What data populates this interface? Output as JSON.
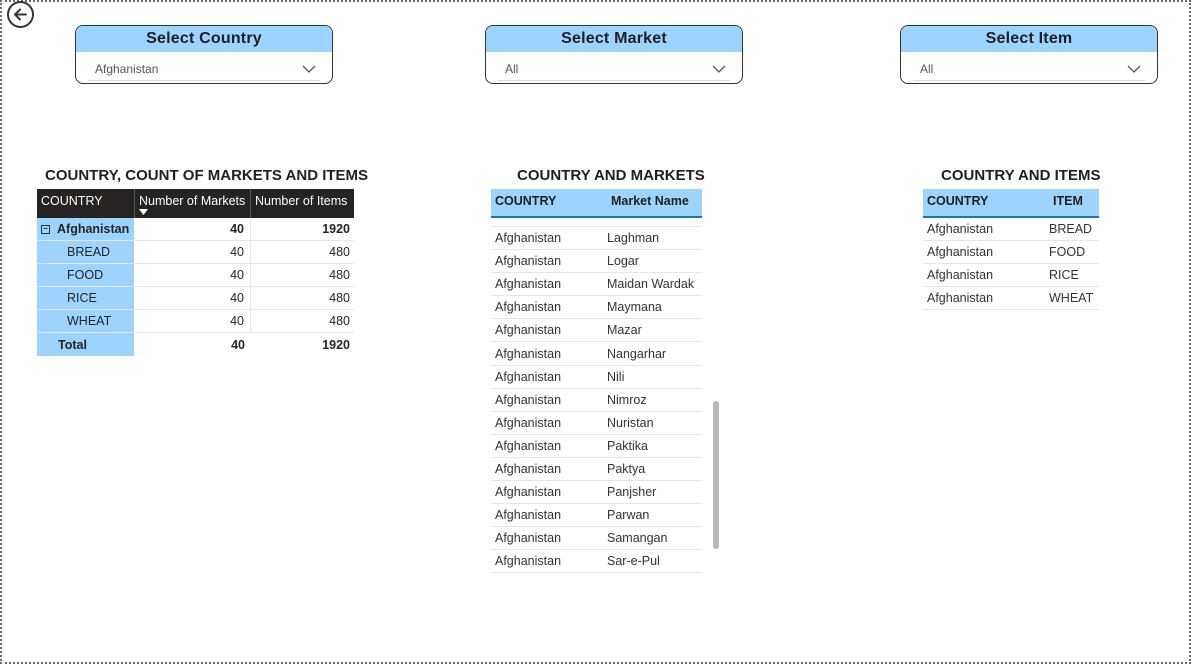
{
  "slicers": {
    "country": {
      "title": "Select Country",
      "value": "Afghanistan"
    },
    "market": {
      "title": "Select Market",
      "value": "All"
    },
    "item": {
      "title": "Select Item",
      "value": "All"
    }
  },
  "matrix": {
    "title": "COUNTRY, COUNT OF MARKETS AND ITEMS",
    "headers": [
      "COUNTRY",
      "Number of Markets",
      "Number of Items"
    ],
    "rows": [
      {
        "label": "Afghanistan",
        "markets": "40",
        "items": "1920"
      },
      {
        "label": "BREAD",
        "markets": "40",
        "items": "480"
      },
      {
        "label": "FOOD",
        "markets": "40",
        "items": "480"
      },
      {
        "label": "RICE",
        "markets": "40",
        "items": "480"
      },
      {
        "label": "WHEAT",
        "markets": "40",
        "items": "480"
      },
      {
        "label": "Total",
        "markets": "40",
        "items": "1920"
      }
    ]
  },
  "markets_table": {
    "title": "COUNTRY AND MARKETS",
    "headers": [
      "COUNTRY",
      "Market Name"
    ],
    "rows": [
      [
        "Afghanistan",
        "Laghman"
      ],
      [
        "Afghanistan",
        "Logar"
      ],
      [
        "Afghanistan",
        "Maidan Wardak"
      ],
      [
        "Afghanistan",
        "Maymana"
      ],
      [
        "Afghanistan",
        "Mazar"
      ],
      [
        "Afghanistan",
        "Nangarhar"
      ],
      [
        "Afghanistan",
        "Nili"
      ],
      [
        "Afghanistan",
        "Nimroz"
      ],
      [
        "Afghanistan",
        "Nuristan"
      ],
      [
        "Afghanistan",
        "Paktika"
      ],
      [
        "Afghanistan",
        "Paktya"
      ],
      [
        "Afghanistan",
        "Panjsher"
      ],
      [
        "Afghanistan",
        "Parwan"
      ],
      [
        "Afghanistan",
        "Samangan"
      ],
      [
        "Afghanistan",
        "Sar-e-Pul"
      ]
    ]
  },
  "items_table": {
    "title": "COUNTRY AND ITEMS",
    "headers": [
      "COUNTRY",
      "ITEM"
    ],
    "rows": [
      [
        "Afghanistan",
        "BREAD"
      ],
      [
        "Afghanistan",
        "FOOD"
      ],
      [
        "Afghanistan",
        "RICE"
      ],
      [
        "Afghanistan",
        "WHEAT"
      ]
    ]
  },
  "colors": {
    "slicer_header": "#9dd3ff",
    "matrix_header": "#252423",
    "accent_border": "#1a73c7"
  },
  "icons": {
    "back": "back-arrow-icon",
    "dropdown": "chevron-down-icon",
    "collapse": "collapse-icon",
    "sort": "sort-desc-icon"
  }
}
